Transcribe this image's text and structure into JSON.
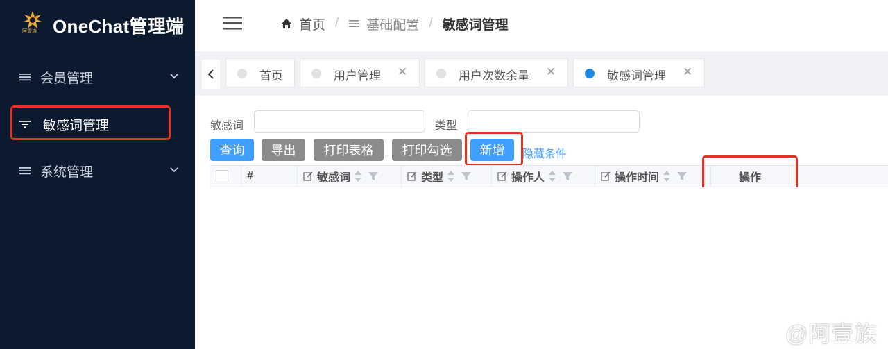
{
  "app": {
    "title": "OneChat管理端",
    "logo_caption": "阿壹族"
  },
  "sidebar": {
    "items": [
      {
        "label": "会员管理",
        "icon": "menu-lines-icon",
        "expandable": true
      },
      {
        "label": "敏感词管理",
        "icon": "filter-lines-icon",
        "active": true
      },
      {
        "label": "系统管理",
        "icon": "menu-lines-icon",
        "expandable": true
      }
    ]
  },
  "breadcrumb": {
    "home": "首页",
    "section": "基础配置",
    "current": "敏感词管理"
  },
  "tabs": [
    {
      "label": "首页",
      "active": false,
      "closable": false
    },
    {
      "label": "用户管理",
      "active": false,
      "closable": true
    },
    {
      "label": "用户次数余量",
      "active": false,
      "closable": true
    },
    {
      "label": "敏感词管理",
      "active": true,
      "closable": true
    }
  ],
  "filters": {
    "word_label": "敏感词",
    "word_value": "",
    "type_label": "类型",
    "type_value": ""
  },
  "actions": {
    "query": "查询",
    "export": "导出",
    "print_table": "打印表格",
    "print_checked": "打印勾选",
    "add": "新增",
    "hide_conditions": "隐藏条件"
  },
  "table": {
    "columns": [
      "#",
      "敏感词",
      "类型",
      "操作人",
      "操作时间",
      "操作"
    ],
    "rows": []
  },
  "watermark": "@阿壹族",
  "colors": {
    "sidebar_bg": "#0b1a2e",
    "accent": "#409eff",
    "gray_button": "#8c8c8c",
    "highlight": "#e53323",
    "active_tab_dot": "#1e88e5"
  }
}
